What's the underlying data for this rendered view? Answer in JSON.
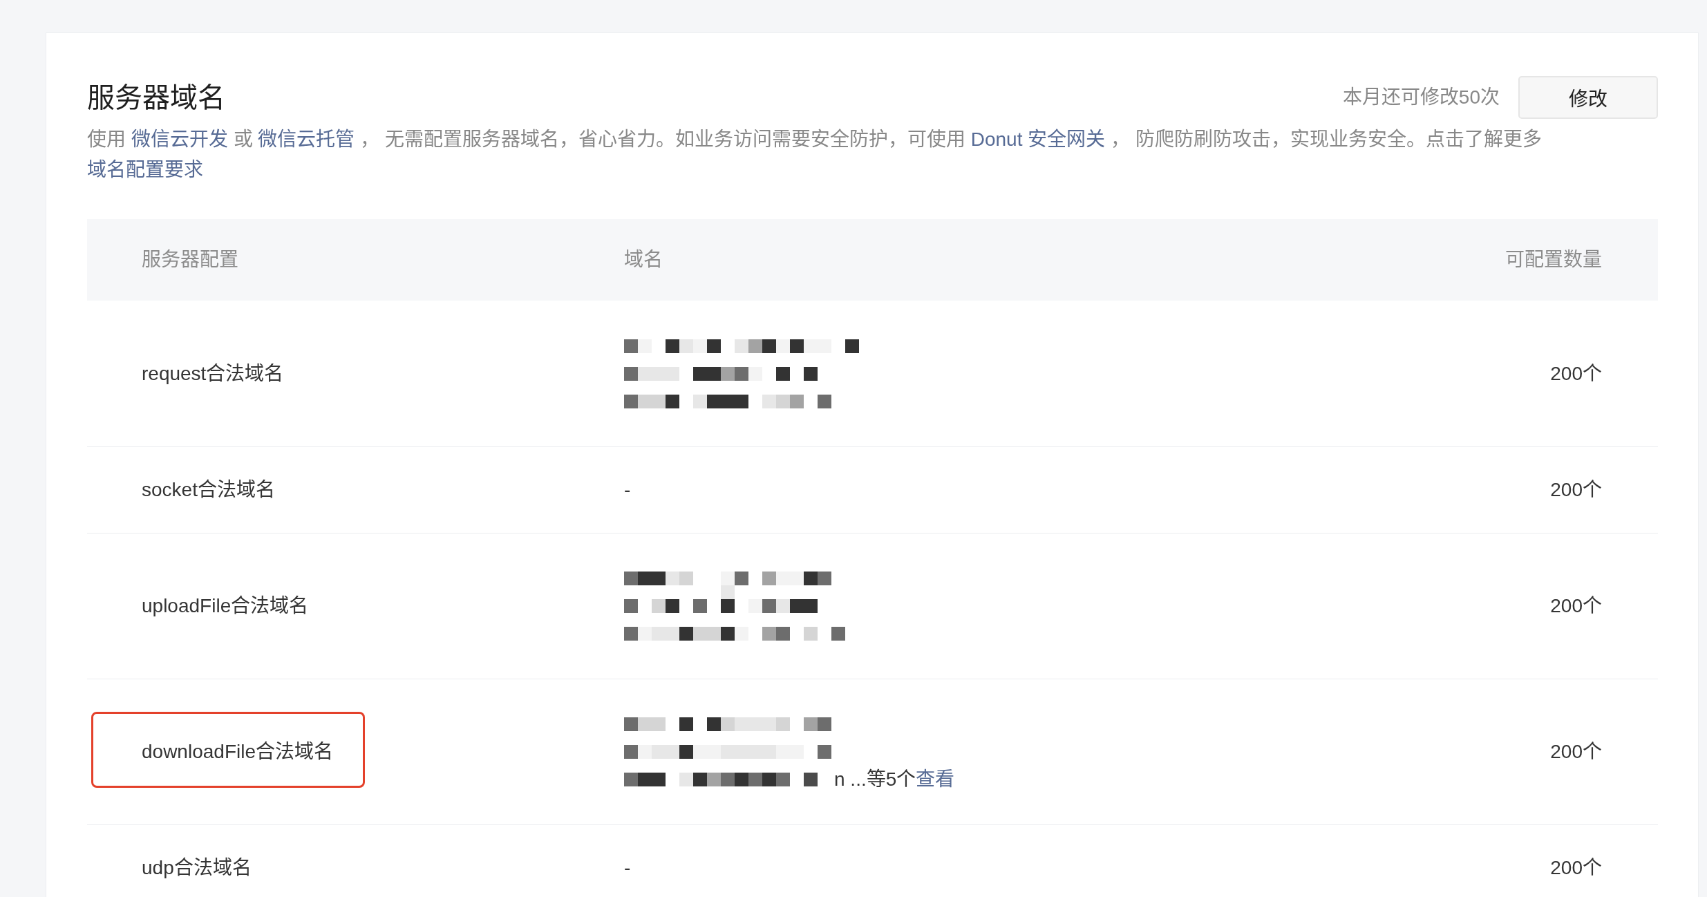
{
  "header": {
    "title": "服务器域名",
    "quota_text": "本月还可修改50次",
    "edit_button": "修改"
  },
  "description": [
    {
      "kind": "text",
      "text": "使用 "
    },
    {
      "kind": "link",
      "text": "微信云开发"
    },
    {
      "kind": "text",
      "text": " 或 "
    },
    {
      "kind": "link",
      "text": "微信云托管"
    },
    {
      "kind": "text",
      "text": " ， 无需配置服务器域名，省心省力。如业务访问需要安全防护，可使用 "
    },
    {
      "kind": "link",
      "text": "Donut 安全网关"
    },
    {
      "kind": "text",
      "text": " ， 防爬防刷防攻击，实现业务安全。点击了解更多 "
    },
    {
      "kind": "link",
      "text": "域名配置要求"
    }
  ],
  "table": {
    "columns": [
      "服务器配置",
      "域名",
      "可配置数量"
    ],
    "rows": [
      {
        "config": "request合法域名",
        "domain": {
          "kind": "redacted"
        },
        "count": "200个",
        "highlighted": false
      },
      {
        "config": "socket合法域名",
        "domain": {
          "kind": "text",
          "text": "-"
        },
        "count": "200个",
        "highlighted": false
      },
      {
        "config": "uploadFile合法域名",
        "domain": {
          "kind": "redacted"
        },
        "count": "200个",
        "highlighted": false
      },
      {
        "config": "downloadFile合法域名",
        "domain": {
          "kind": "redacted",
          "more_text": "n ...等5个",
          "more_link": "查看"
        },
        "count": "200个",
        "highlighted": true
      },
      {
        "config": "udp合法域名",
        "domain": {
          "kind": "text",
          "text": "-"
        },
        "count": "200个",
        "highlighted": false
      }
    ]
  }
}
